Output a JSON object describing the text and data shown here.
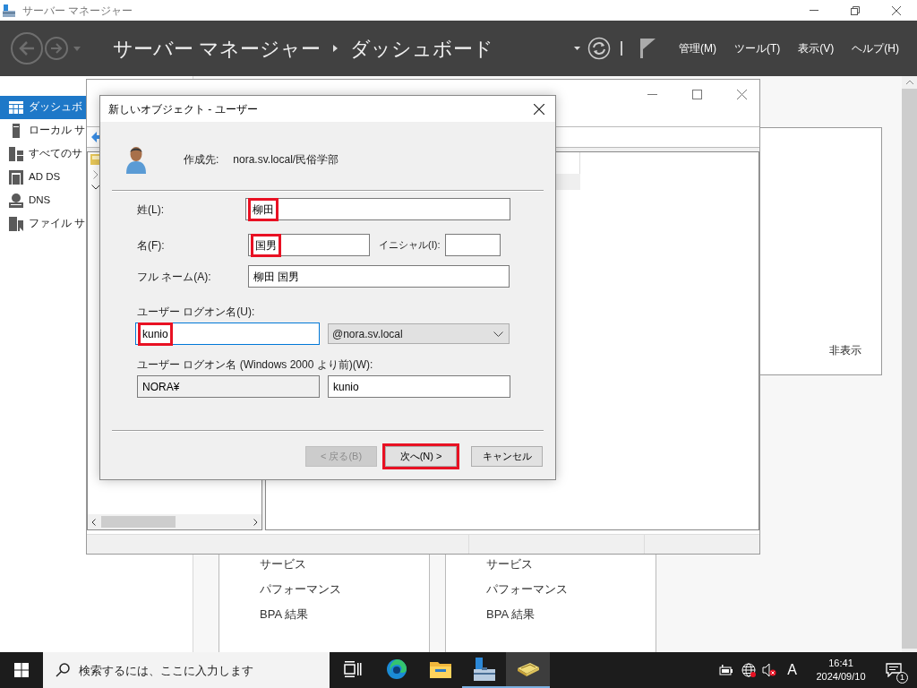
{
  "title_bar": {
    "title": "サーバー マネージャー"
  },
  "header": {
    "breadcrumb": [
      "サーバー マネージャー",
      "ダッシュボード"
    ],
    "menus": [
      "管理(M)",
      "ツール(T)",
      "表示(V)",
      "ヘルプ(H)"
    ]
  },
  "sidebar": {
    "items": [
      {
        "label": "ダッシュボ",
        "kind": "dashboard",
        "selected": true
      },
      {
        "label": "ローカル サ",
        "kind": "server",
        "selected": false
      },
      {
        "label": "すべてのサ",
        "kind": "servers",
        "selected": false
      },
      {
        "label": "AD DS",
        "kind": "adds",
        "selected": false
      },
      {
        "label": "DNS",
        "kind": "dns",
        "selected": false
      },
      {
        "label": "ファイル サ",
        "kind": "file",
        "selected": false
      }
    ]
  },
  "welcome_panel": {
    "hide_link": "非表示"
  },
  "tiles": [
    {
      "items": [
        "サービス",
        "パフォーマンス",
        "BPA 結果"
      ]
    },
    {
      "items": [
        "サービス",
        "パフォーマンス",
        "BPA 結果"
      ]
    }
  ],
  "dialog": {
    "title": "新しいオブジェクト - ユーザー",
    "create_in_label": "作成先:",
    "create_in": "nora.sv.local/民俗学部",
    "last_name": {
      "label": "姓(L):",
      "value": "柳田",
      "highlighted": true
    },
    "first_name": {
      "label": "名(F):",
      "value": "国男",
      "highlighted": true
    },
    "initials": {
      "label": "イニシャル(I):"
    },
    "full_name": {
      "label": "フル ネーム(A):",
      "value": "柳田 国男",
      "highlighted": false
    },
    "logon_name": {
      "label": "ユーザー ログオン名(U):",
      "value": "kunio",
      "highlighted": true,
      "focused": true
    },
    "domain": {
      "value": "@nora.sv.local"
    },
    "pre2000": {
      "label": "ユーザー ログオン名 (Windows 2000 より前)(W):",
      "domain": "NORA¥",
      "value": "kunio"
    },
    "buttons": [
      {
        "label": "< 戻る(B)",
        "disabled": true,
        "highlighted": false
      },
      {
        "label": "次へ(N) >",
        "disabled": false,
        "highlighted": true
      },
      {
        "label": "キャンセル",
        "disabled": false,
        "highlighted": false
      }
    ]
  },
  "taskbar": {
    "search": {
      "placeholder": "検索するには、ここに入力します"
    },
    "apps": [
      {
        "kind": "taskview",
        "selected": false,
        "running": false
      },
      {
        "kind": "edge",
        "selected": false,
        "running": false
      },
      {
        "kind": "explorer",
        "selected": false,
        "running": false
      },
      {
        "kind": "servermanager",
        "selected": false,
        "running": true
      },
      {
        "kind": "aduc",
        "selected": true,
        "running": true
      }
    ],
    "ime": "A",
    "time": "16:41",
    "date": "2024/09/10",
    "notifications": "1"
  }
}
